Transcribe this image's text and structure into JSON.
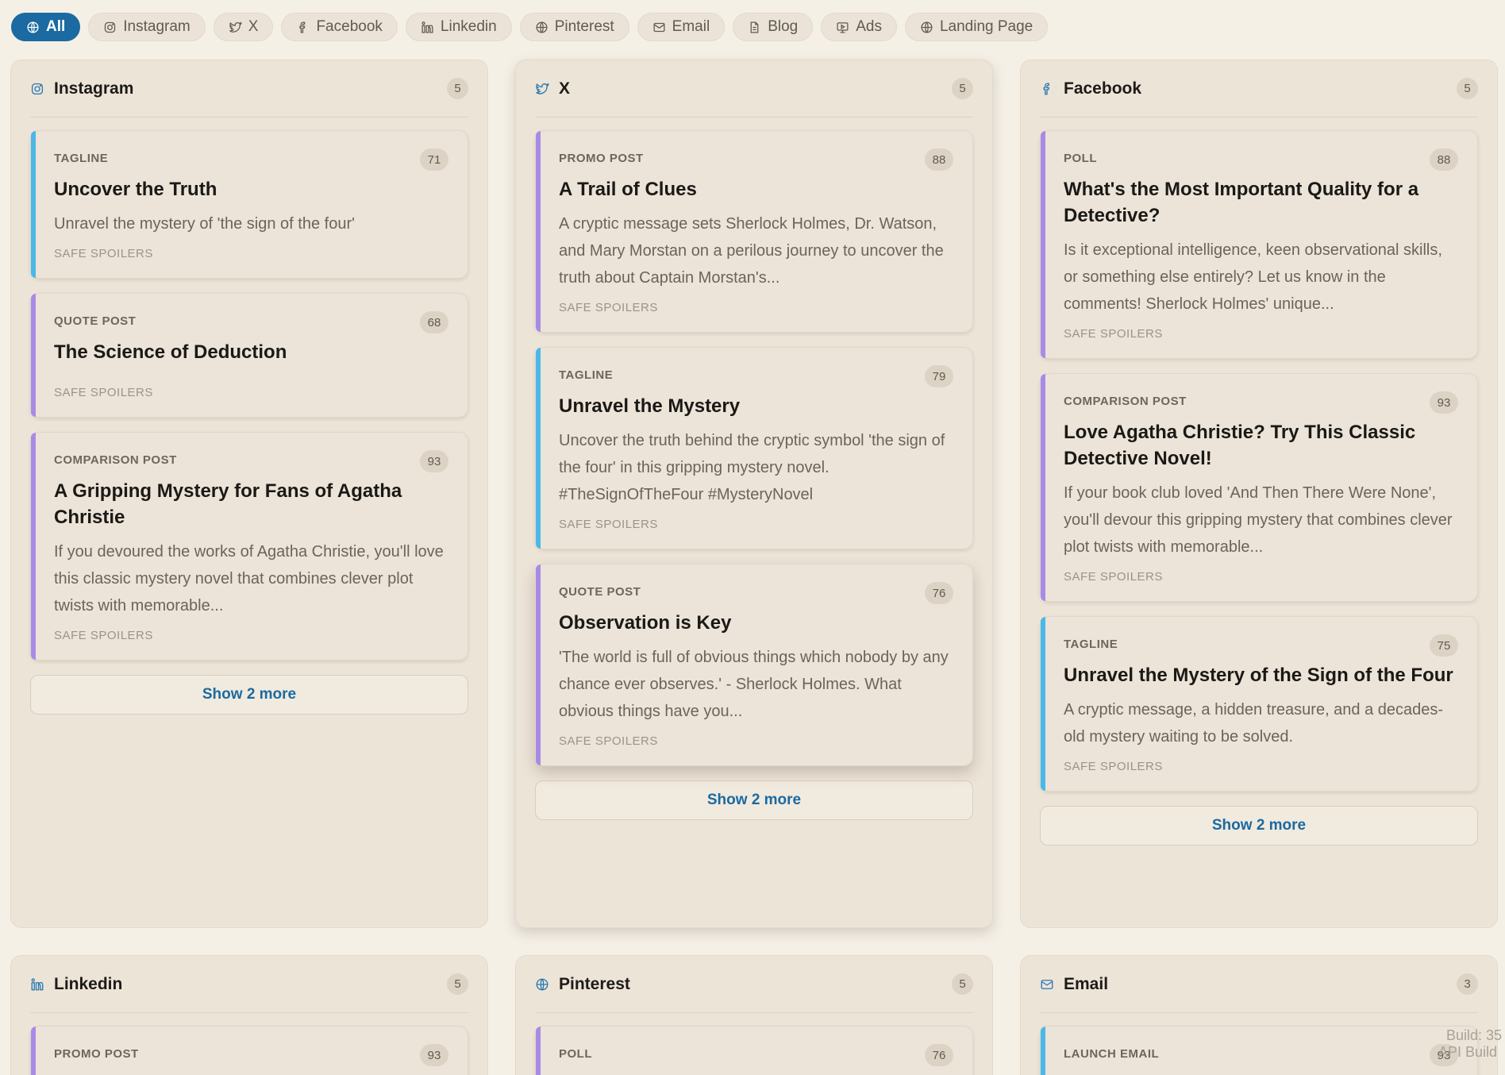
{
  "filters": [
    {
      "label": "All",
      "icon": "globe-icon",
      "active": true
    },
    {
      "label": "Instagram",
      "icon": "instagram-icon"
    },
    {
      "label": "X",
      "icon": "twitter-icon"
    },
    {
      "label": "Facebook",
      "icon": "facebook-icon"
    },
    {
      "label": "Linkedin",
      "icon": "linkedin-icon"
    },
    {
      "label": "Pinterest",
      "icon": "globe-icon"
    },
    {
      "label": "Email",
      "icon": "mail-icon"
    },
    {
      "label": "Blog",
      "icon": "document-icon"
    },
    {
      "label": "Ads",
      "icon": "ads-icon"
    },
    {
      "label": "Landing Page",
      "icon": "globe-icon"
    }
  ],
  "columns": [
    {
      "name": "Instagram",
      "icon": "instagram-icon",
      "count": "5",
      "cards": [
        {
          "type": "TAGLINE",
          "score": "71",
          "title": "Uncover the Truth",
          "body": "Unravel the mystery of 'the sign of the four'",
          "foot": "SAFE SPOILERS"
        },
        {
          "type": "QUOTE POST",
          "score": "68",
          "title": "The Science of Deduction",
          "body": "",
          "foot": "SAFE SPOILERS"
        },
        {
          "type": "COMPARISON POST",
          "score": "93",
          "title": "A Gripping Mystery for Fans of Agatha Christie",
          "body": "If you devoured the works of Agatha Christie, you'll love this classic mystery novel that combines clever plot twists with memorable...",
          "foot": "SAFE SPOILERS"
        }
      ],
      "more": "Show 2 more"
    },
    {
      "name": "X",
      "icon": "twitter-icon",
      "count": "5",
      "cards": [
        {
          "type": "PROMO POST",
          "score": "88",
          "title": "A Trail of Clues",
          "body": "A cryptic message sets Sherlock Holmes, Dr. Watson, and Mary Morstan on a perilous journey to uncover the truth about Captain Morstan's...",
          "foot": "SAFE SPOILERS"
        },
        {
          "type": "TAGLINE",
          "score": "79",
          "title": "Unravel the Mystery",
          "body": "Uncover the truth behind the cryptic symbol 'the sign of the four' in this gripping mystery novel. #TheSignOfTheFour #MysteryNovel",
          "foot": "SAFE SPOILERS"
        },
        {
          "type": "QUOTE POST",
          "score": "76",
          "title": "Observation is Key",
          "body": "'The world is full of obvious things which nobody by any chance ever observes.' - Sherlock Holmes. What obvious things have you...",
          "foot": "SAFE SPOILERS"
        }
      ],
      "more": "Show 2 more"
    },
    {
      "name": "Facebook",
      "icon": "facebook-icon",
      "count": "5",
      "cards": [
        {
          "type": "POLL",
          "score": "88",
          "title": "What's the Most Important Quality for a Detective?",
          "body": "Is it exceptional intelligence, keen observational skills, or something else entirely? Let us know in the comments! Sherlock Holmes' unique...",
          "foot": "SAFE SPOILERS"
        },
        {
          "type": "COMPARISON POST",
          "score": "93",
          "title": "Love Agatha Christie? Try This Classic Detective Novel!",
          "body": "If your book club loved 'And Then There Were None', you'll devour this gripping mystery that combines clever plot twists with memorable...",
          "foot": "SAFE SPOILERS"
        },
        {
          "type": "TAGLINE",
          "score": "75",
          "title": "Unravel the Mystery of the Sign of the Four",
          "body": "A cryptic message, a hidden treasure, and a decades-old mystery waiting to be solved.",
          "foot": "SAFE SPOILERS"
        }
      ],
      "more": "Show 2 more"
    },
    {
      "name": "Linkedin",
      "icon": "linkedin-icon",
      "count": "5",
      "cards": [
        {
          "type": "PROMO POST",
          "score": "93"
        }
      ]
    },
    {
      "name": "Pinterest",
      "icon": "globe-icon",
      "count": "5",
      "cards": [
        {
          "type": "POLL",
          "score": "76"
        }
      ]
    },
    {
      "name": "Email",
      "icon": "mail-icon",
      "count": "3",
      "cards": [
        {
          "type": "LAUNCH EMAIL",
          "score": "93"
        }
      ]
    }
  ],
  "build": {
    "line1": "Build: 35",
    "line2": "API Build"
  },
  "colors": {
    "accent": "#1b6aa1",
    "tagline_bar": "#4cb8e8",
    "post_bar": "#a98be6",
    "background": "#f5f0e6"
  }
}
